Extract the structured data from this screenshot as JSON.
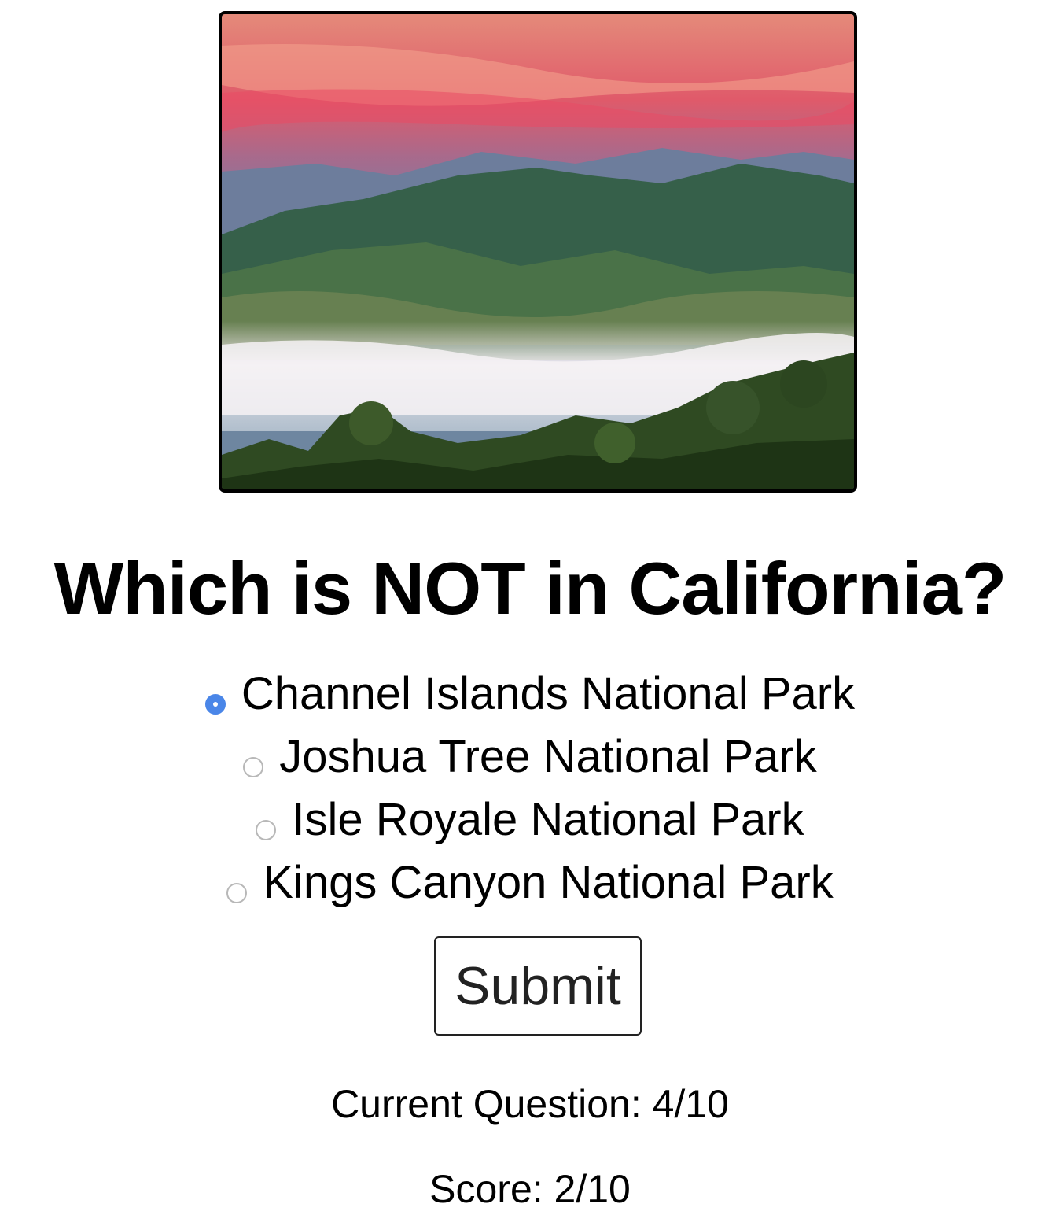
{
  "image": {
    "alt": "Smoky mountain ridges under a pink sunset sky with fog over the valley"
  },
  "question": {
    "text": "Which is NOT in California?"
  },
  "options": [
    {
      "label": "Channel Islands National Park",
      "selected": true
    },
    {
      "label": "Joshua Tree National Park",
      "selected": false
    },
    {
      "label": "Isle Royale National Park",
      "selected": false
    },
    {
      "label": "Kings Canyon National Park",
      "selected": false
    }
  ],
  "submit": {
    "label": "Submit"
  },
  "status": {
    "current_question": "Current Question: 4/10",
    "score": "Score: 2/10"
  },
  "colors": {
    "radio_selected": "#4a86e8",
    "radio_unselected_border": "#b8b8b8"
  }
}
